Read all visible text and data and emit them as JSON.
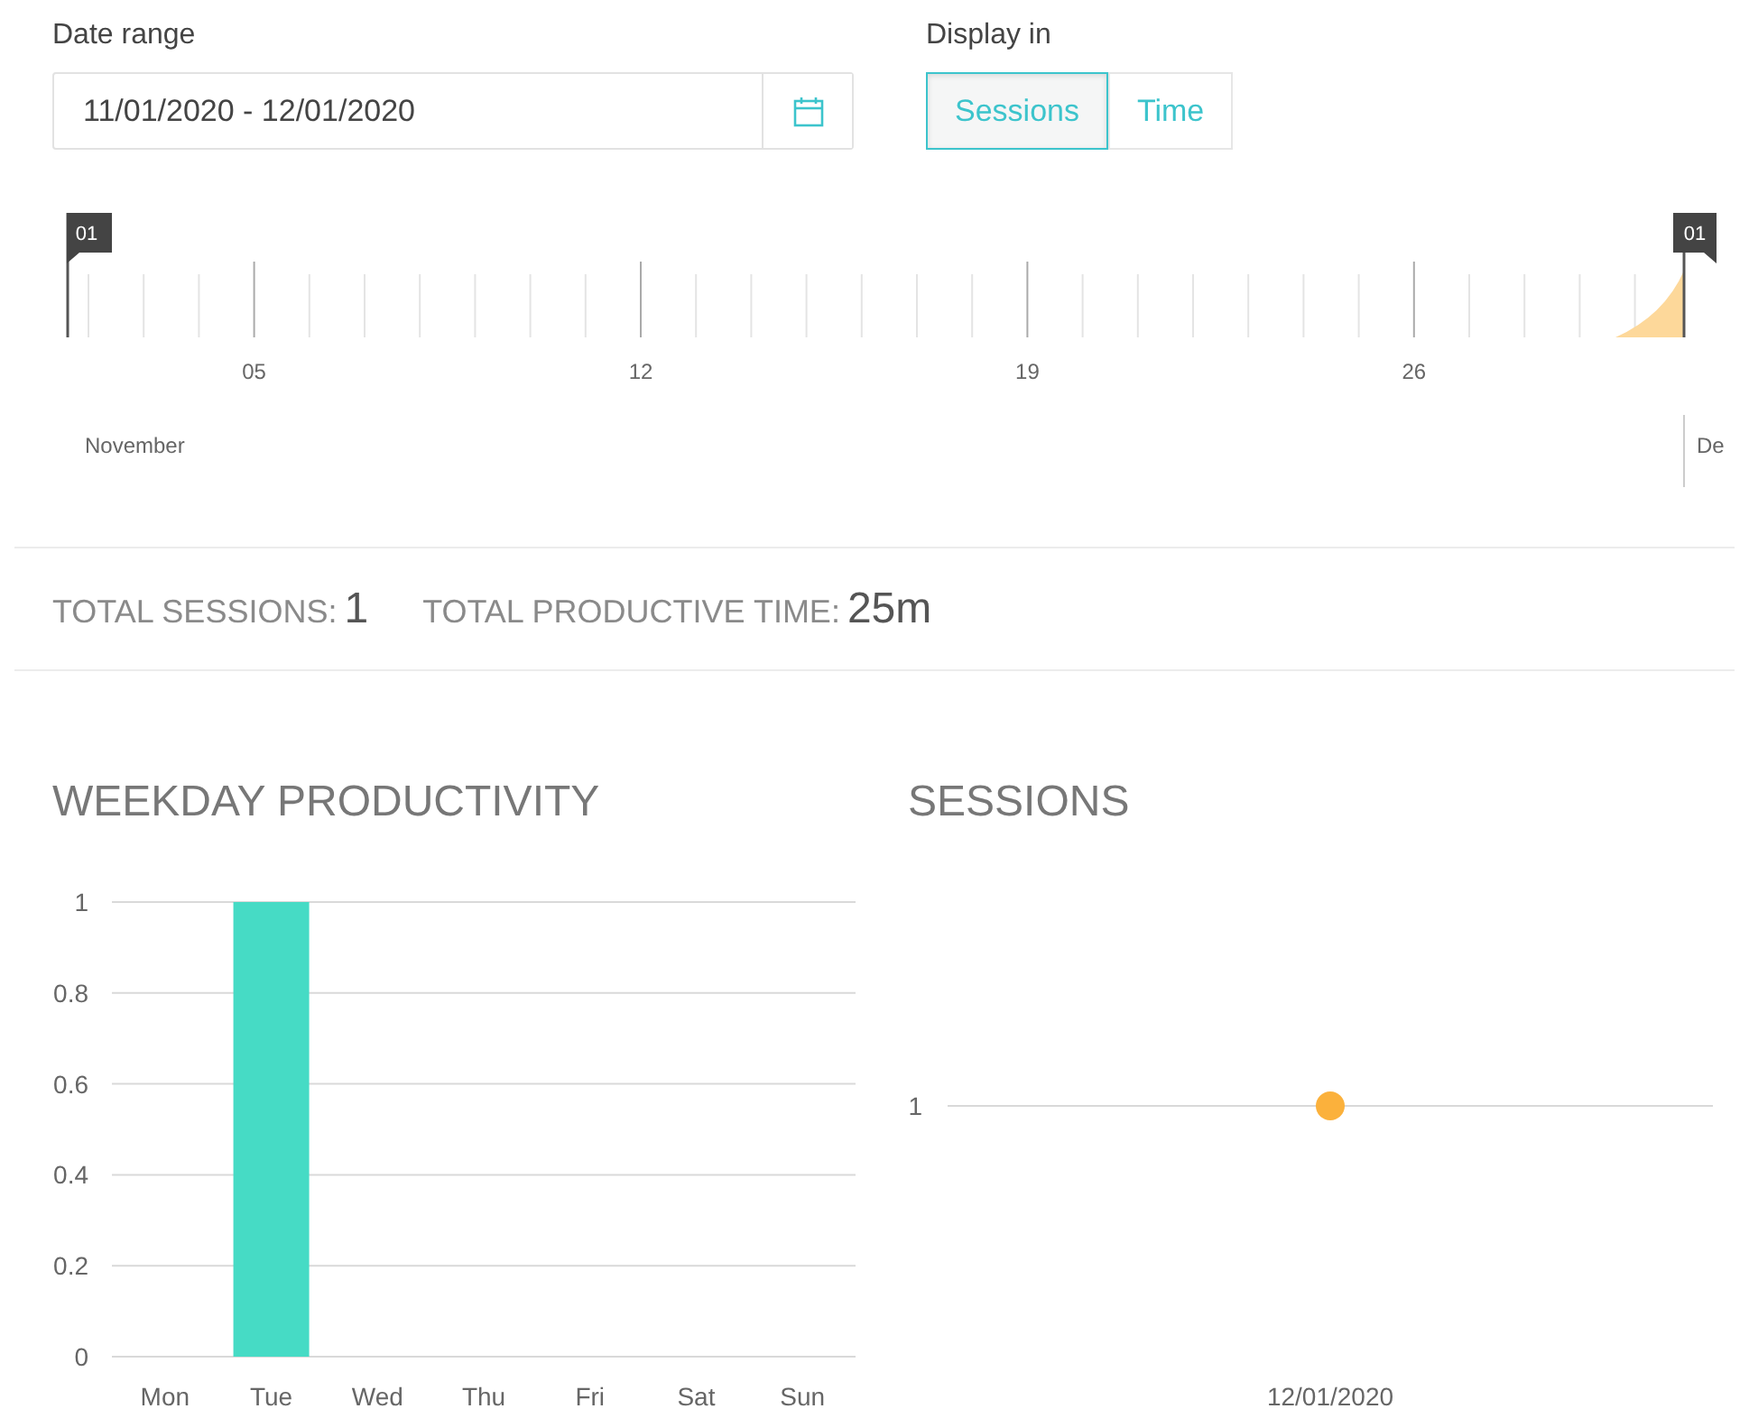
{
  "filters": {
    "date_range": {
      "label": "Date range",
      "value": "11/01/2020 - 12/01/2020"
    },
    "display_in": {
      "label": "Display in",
      "options": [
        {
          "label": "Sessions",
          "selected": true
        },
        {
          "label": "Time",
          "selected": false
        }
      ]
    }
  },
  "timeline": {
    "start_handle": "01",
    "end_handle": "01",
    "day_ticks": [
      "05",
      "12",
      "19",
      "26"
    ],
    "months": [
      "November",
      "De"
    ]
  },
  "totals": [
    {
      "label": "TOTAL SESSIONS:",
      "value": "1"
    },
    {
      "label": "TOTAL PRODUCTIVE TIME:",
      "value": "25m"
    }
  ],
  "weekday_productivity": {
    "title": "WEEKDAY PRODUCTIVITY",
    "chart_data": {
      "type": "bar",
      "categories": [
        "Mon",
        "Tue",
        "Wed",
        "Thu",
        "Fri",
        "Sat",
        "Sun"
      ],
      "series": [
        {
          "color": "#46dbc5",
          "values": [
            0,
            1,
            0,
            0,
            0,
            0,
            0
          ]
        }
      ],
      "ylim": [
        0,
        1
      ],
      "yticks": [
        0,
        0.2,
        0.4,
        0.6,
        0.8,
        1
      ],
      "grid": true
    }
  },
  "sessions": {
    "title": "SESSIONS",
    "y_axis_label": "1",
    "x_axis_label": "12/01/2020"
  }
}
